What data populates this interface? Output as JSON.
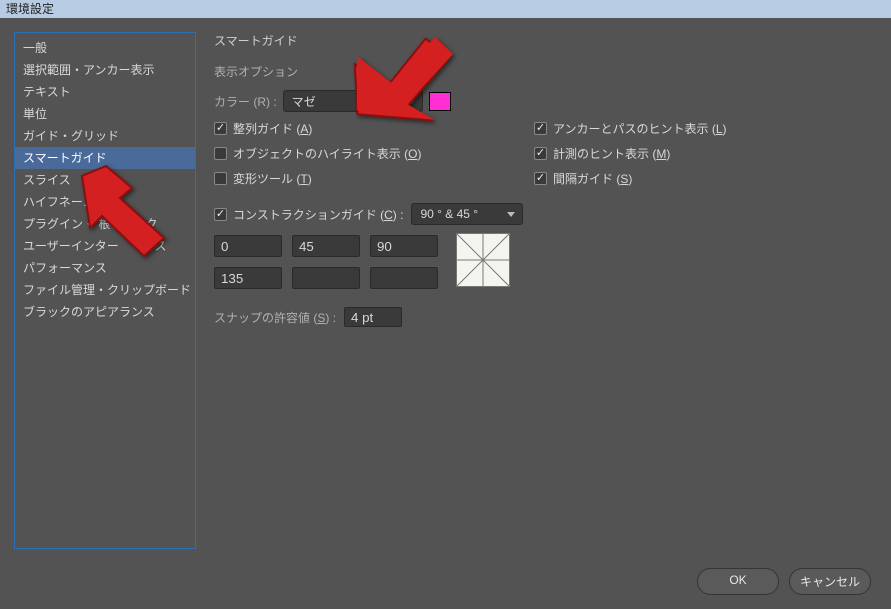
{
  "window": {
    "title": "環境設定"
  },
  "sidebar": {
    "items": [
      {
        "label": "一般"
      },
      {
        "label": "選択範囲・アンカー表示"
      },
      {
        "label": "テキスト"
      },
      {
        "label": "単位"
      },
      {
        "label": "ガイド・グリッド"
      },
      {
        "label": "スマートガイド"
      },
      {
        "label": "スライス"
      },
      {
        "label": "ハイフネー…"
      },
      {
        "label": "プラグイン・    根ディスク"
      },
      {
        "label": "ユーザーインター　　イス"
      },
      {
        "label": "パフォーマンス"
      },
      {
        "label": "ファイル管理・クリップボード"
      },
      {
        "label": "ブラックのアピアランス"
      }
    ],
    "selected_index": 5
  },
  "panel": {
    "title": "スマートガイド",
    "display_options_title": "表示オプション",
    "color_label": "カラー (R) :",
    "color_shortcut": "R",
    "color_value": "マゼ",
    "swatch_color": "#ff2fd4",
    "checks": {
      "alignment": {
        "checked": true,
        "label": "整列ガイド (",
        "shortcut": "A",
        "suffix": ")"
      },
      "highlight": {
        "checked": false,
        "label": "オブジェクトのハイライト表示 (",
        "shortcut": "O",
        "suffix": ")"
      },
      "transform": {
        "checked": false,
        "label": "変形ツール (",
        "shortcut": "T",
        "suffix": ")"
      },
      "anchor": {
        "checked": true,
        "label": "アンカーとパスのヒント表示 (",
        "shortcut": "L",
        "suffix": ")"
      },
      "measure": {
        "checked": true,
        "label": "計測のヒント表示 (",
        "shortcut": "M",
        "suffix": ")"
      },
      "spacing": {
        "checked": true,
        "label": "間隔ガイド (",
        "shortcut": "S",
        "suffix": ")"
      }
    },
    "construction": {
      "checked": true,
      "label": "コンストラクションガイド (",
      "shortcut": "C",
      "suffix": ") :",
      "value": "90 ° & 45 °"
    },
    "angles": {
      "a0": "0",
      "a1": "45",
      "a2": "90",
      "a3": "135",
      "a4": "",
      "a5": ""
    },
    "snap": {
      "label": "スナップの許容値 (",
      "shortcut": "S",
      "suffix": ") :",
      "value": "4 pt"
    }
  },
  "footer": {
    "ok": "OK",
    "cancel": "キャンセル"
  }
}
